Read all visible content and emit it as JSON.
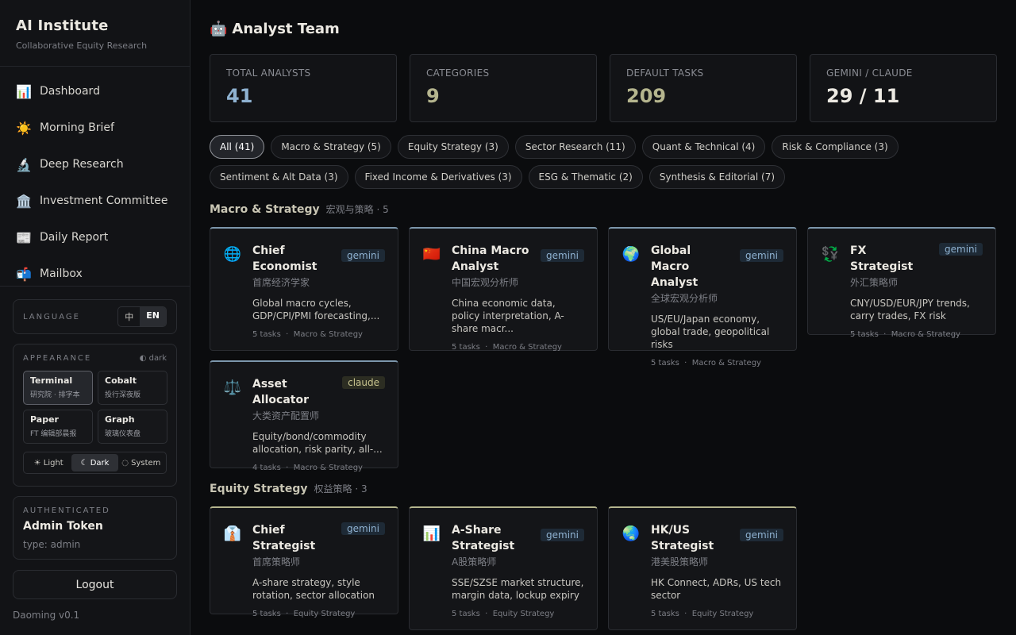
{
  "brand": {
    "title": "AI Institute",
    "subtitle": "Collaborative Equity Research"
  },
  "nav": [
    {
      "label": "Dashboard",
      "icon": "📊"
    },
    {
      "label": "Morning Brief",
      "icon": "☀️"
    },
    {
      "label": "Deep Research",
      "icon": "🔬"
    },
    {
      "label": "Investment Committee",
      "icon": "🏛️"
    },
    {
      "label": "Daily Report",
      "icon": "📰"
    },
    {
      "label": "Mailbox",
      "icon": "📬"
    }
  ],
  "language": {
    "label": "LANGUAGE",
    "options": [
      "中",
      "EN"
    ],
    "selected": "EN"
  },
  "appearance": {
    "label": "APPEARANCE",
    "mode_indicator": "◐ dark",
    "themes": [
      {
        "name": "Terminal",
        "sub": "研究院 · 排字本",
        "selected": true
      },
      {
        "name": "Cobalt",
        "sub": "投行深夜版",
        "selected": false
      },
      {
        "name": "Paper",
        "sub": "FT 编辑部晨报",
        "selected": false
      },
      {
        "name": "Graph",
        "sub": "玻璃仪表盘",
        "selected": false
      }
    ],
    "modes": [
      {
        "label": "☀ Light",
        "selected": false
      },
      {
        "label": "☾ Dark",
        "selected": true
      },
      {
        "label": "◌ System",
        "selected": false
      }
    ]
  },
  "auth": {
    "label": "AUTHENTICATED",
    "name": "Admin Token",
    "type": "type: admin"
  },
  "logout": "Logout",
  "version": "Daoming v0.1",
  "page": {
    "title": "Analyst Team",
    "icon": "🤖"
  },
  "stats": [
    {
      "label": "TOTAL ANALYSTS",
      "value": "41",
      "color": "#8fb2d1"
    },
    {
      "label": "CATEGORIES",
      "value": "9",
      "color": "#b5b58e"
    },
    {
      "label": "DEFAULT TASKS",
      "value": "209",
      "color": "#b5b58e"
    },
    {
      "label": "GEMINI / CLAUDE",
      "value": "29 / 11",
      "color": "#ece9e2"
    }
  ],
  "filters": [
    {
      "label": "All (41)",
      "selected": true
    },
    {
      "label": "Macro & Strategy (5)",
      "selected": false
    },
    {
      "label": "Equity Strategy (3)",
      "selected": false
    },
    {
      "label": "Sector Research (11)",
      "selected": false
    },
    {
      "label": "Quant & Technical (4)",
      "selected": false
    },
    {
      "label": "Risk & Compliance (3)",
      "selected": false
    },
    {
      "label": "Sentiment & Alt Data (3)",
      "selected": false
    },
    {
      "label": "Fixed Income & Derivatives (3)",
      "selected": false
    },
    {
      "label": "ESG & Thematic (2)",
      "selected": false
    },
    {
      "label": "Synthesis & Editorial (7)",
      "selected": false
    }
  ],
  "sections": [
    {
      "name": "Macro & Strategy",
      "sub": "宏观与策略 · 5",
      "cards": [
        {
          "icon": "🌐",
          "name": "Chief Economist",
          "cn": "首席经济学家",
          "model": "gemini",
          "desc": "Global macro cycles, GDP/CPI/PMI forecasting,...",
          "meta": "5 tasks  ·  Macro & Strategy"
        },
        {
          "icon": "🇨🇳",
          "name": "China Macro Analyst",
          "cn": "中国宏观分析师",
          "model": "gemini",
          "desc": "China economic data, policy interpretation, A-share macr...",
          "meta": "5 tasks  ·  Macro & Strategy"
        },
        {
          "icon": "🌍",
          "name": "Global Macro Analyst",
          "cn": "全球宏观分析师",
          "model": "gemini",
          "desc": "US/EU/Japan economy, global trade, geopolitical risks",
          "meta": "5 tasks  ·  Macro & Strategy"
        },
        {
          "icon": "💱",
          "name": "FX Strategist",
          "cn": "外汇策略师",
          "model": "gemini",
          "desc": "CNY/USD/EUR/JPY trends, carry trades, FX risk",
          "meta": "5 tasks  ·  Macro & Strategy"
        },
        {
          "icon": "⚖️",
          "name": "Asset Allocator",
          "cn": "大类资产配置师",
          "model": "claude",
          "desc": "Equity/bond/commodity allocation, risk parity, all-...",
          "meta": "4 tasks  ·  Macro & Strategy"
        }
      ]
    },
    {
      "name": "Equity Strategy",
      "sub": "权益策略 · 3",
      "cards": [
        {
          "icon": "👔",
          "name": "Chief Strategist",
          "cn": "首席策略师",
          "model": "gemini",
          "desc": "A-share strategy, style rotation, sector allocation",
          "meta": "5 tasks  ·  Equity Strategy"
        },
        {
          "icon": "📊",
          "name": "A-Share Strategist",
          "cn": "A股策略师",
          "model": "gemini",
          "desc": "SSE/SZSE market structure, margin data, lockup expiry",
          "meta": "5 tasks  ·  Equity Strategy"
        },
        {
          "icon": "🌏",
          "name": "HK/US Strategist",
          "cn": "港美股策略师",
          "model": "gemini",
          "desc": "HK Connect, ADRs, US tech sector",
          "meta": "5 tasks  ·  Equity Strategy"
        }
      ]
    }
  ]
}
